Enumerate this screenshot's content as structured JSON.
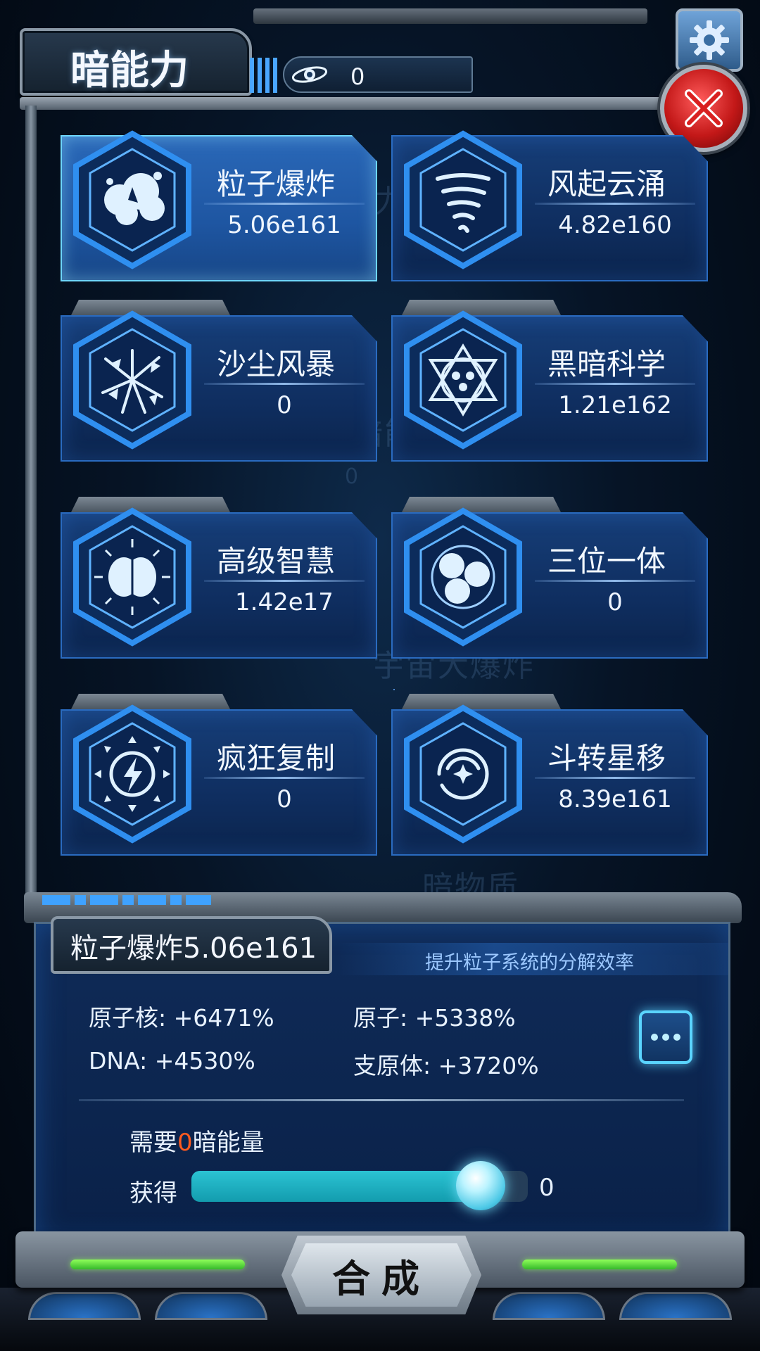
{
  "header": {
    "title": "暗能力",
    "currency_value": "0"
  },
  "background_ghost_text": [
    "暗能力",
    "暗能量",
    "0",
    "宇宙大爆炸",
    "暗物质"
  ],
  "skills": [
    {
      "name": "粒子爆炸",
      "value": "5.06e161",
      "icon": "particle-explosion-icon",
      "selected": true
    },
    {
      "name": "风起云涌",
      "value": "4.82e160",
      "icon": "tornado-icon",
      "selected": false
    },
    {
      "name": "沙尘风暴",
      "value": "0",
      "icon": "sandstorm-shards-icon",
      "selected": false
    },
    {
      "name": "黑暗科学",
      "value": "1.21e162",
      "icon": "hexagram-science-icon",
      "selected": false
    },
    {
      "name": "高级智慧",
      "value": "1.42e17",
      "icon": "brain-icon",
      "selected": false
    },
    {
      "name": "三位一体",
      "value": "0",
      "icon": "trinity-orbs-icon",
      "selected": false
    },
    {
      "name": "疯狂复制",
      "value": "0",
      "icon": "lightning-replicate-icon",
      "selected": false
    },
    {
      "name": "斗转星移",
      "value": "8.39e161",
      "icon": "vortex-star-icon",
      "selected": false
    }
  ],
  "detail": {
    "title": "粒子爆炸5.06e161",
    "description": "提升粒子系统的分解效率",
    "stats": [
      {
        "label": "原子核: +6471%"
      },
      {
        "label": "原子: +5338%"
      },
      {
        "label": "DNA: +4530%"
      },
      {
        "label": "支原体: +3720%"
      }
    ],
    "need_prefix": "需要",
    "need_amount": "0",
    "need_suffix": "暗能量",
    "gain_label": "获得",
    "gain_value": "0",
    "slider_fraction": 0.86
  },
  "footer": {
    "compose_label": "合成"
  },
  "colors": {
    "accent": "#2a6bc0",
    "selected_glow": "#6ed6ff",
    "highlight_number": "#ff5a1f",
    "slider_fill": "#2bc3d3",
    "close_red": "#c31818"
  }
}
